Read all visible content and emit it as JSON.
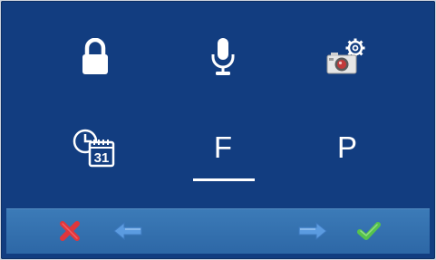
{
  "menu": {
    "items": [
      {
        "id": "lock",
        "icon": "lock-icon"
      },
      {
        "id": "microphone",
        "icon": "microphone-icon"
      },
      {
        "id": "camera-settings",
        "icon": "camera-settings-icon"
      },
      {
        "id": "date-time",
        "icon": "clock-calendar-icon",
        "calendar_day": "31"
      },
      {
        "id": "f",
        "label": "F",
        "selected": true
      },
      {
        "id": "p",
        "label": "P"
      }
    ]
  },
  "toolbar": {
    "buttons": [
      {
        "id": "cancel",
        "icon": "close-icon"
      },
      {
        "id": "previous",
        "icon": "arrow-left-icon"
      },
      {
        "id": "next",
        "icon": "arrow-right-icon"
      },
      {
        "id": "confirm",
        "icon": "checkmark-icon"
      }
    ]
  },
  "colors": {
    "background": "#123d80",
    "bar": "#3471ae",
    "cancel": "#e0363c",
    "confirm": "#56c34c",
    "arrow": "#5b9be0"
  }
}
